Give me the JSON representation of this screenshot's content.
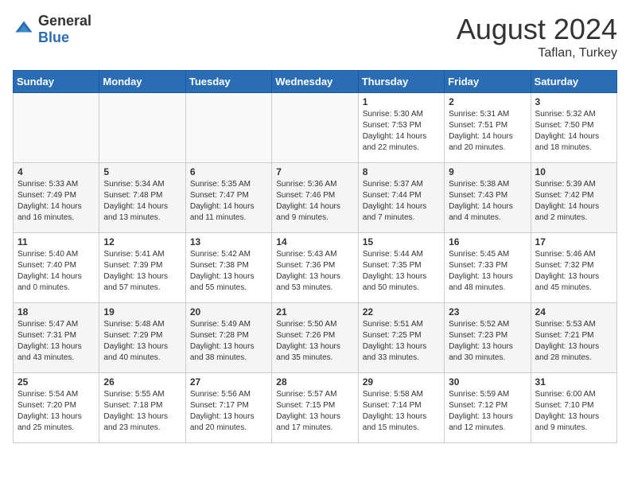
{
  "header": {
    "logo_general": "General",
    "logo_blue": "Blue",
    "month_year": "August 2024",
    "location": "Taflan, Turkey"
  },
  "days_of_week": [
    "Sunday",
    "Monday",
    "Tuesday",
    "Wednesday",
    "Thursday",
    "Friday",
    "Saturday"
  ],
  "weeks": [
    [
      {
        "day": "",
        "info": ""
      },
      {
        "day": "",
        "info": ""
      },
      {
        "day": "",
        "info": ""
      },
      {
        "day": "",
        "info": ""
      },
      {
        "day": "1",
        "info": "Sunrise: 5:30 AM\nSunset: 7:53 PM\nDaylight: 14 hours\nand 22 minutes."
      },
      {
        "day": "2",
        "info": "Sunrise: 5:31 AM\nSunset: 7:51 PM\nDaylight: 14 hours\nand 20 minutes."
      },
      {
        "day": "3",
        "info": "Sunrise: 5:32 AM\nSunset: 7:50 PM\nDaylight: 14 hours\nand 18 minutes."
      }
    ],
    [
      {
        "day": "4",
        "info": "Sunrise: 5:33 AM\nSunset: 7:49 PM\nDaylight: 14 hours\nand 16 minutes."
      },
      {
        "day": "5",
        "info": "Sunrise: 5:34 AM\nSunset: 7:48 PM\nDaylight: 14 hours\nand 13 minutes."
      },
      {
        "day": "6",
        "info": "Sunrise: 5:35 AM\nSunset: 7:47 PM\nDaylight: 14 hours\nand 11 minutes."
      },
      {
        "day": "7",
        "info": "Sunrise: 5:36 AM\nSunset: 7:46 PM\nDaylight: 14 hours\nand 9 minutes."
      },
      {
        "day": "8",
        "info": "Sunrise: 5:37 AM\nSunset: 7:44 PM\nDaylight: 14 hours\nand 7 minutes."
      },
      {
        "day": "9",
        "info": "Sunrise: 5:38 AM\nSunset: 7:43 PM\nDaylight: 14 hours\nand 4 minutes."
      },
      {
        "day": "10",
        "info": "Sunrise: 5:39 AM\nSunset: 7:42 PM\nDaylight: 14 hours\nand 2 minutes."
      }
    ],
    [
      {
        "day": "11",
        "info": "Sunrise: 5:40 AM\nSunset: 7:40 PM\nDaylight: 14 hours\nand 0 minutes."
      },
      {
        "day": "12",
        "info": "Sunrise: 5:41 AM\nSunset: 7:39 PM\nDaylight: 13 hours\nand 57 minutes."
      },
      {
        "day": "13",
        "info": "Sunrise: 5:42 AM\nSunset: 7:38 PM\nDaylight: 13 hours\nand 55 minutes."
      },
      {
        "day": "14",
        "info": "Sunrise: 5:43 AM\nSunset: 7:36 PM\nDaylight: 13 hours\nand 53 minutes."
      },
      {
        "day": "15",
        "info": "Sunrise: 5:44 AM\nSunset: 7:35 PM\nDaylight: 13 hours\nand 50 minutes."
      },
      {
        "day": "16",
        "info": "Sunrise: 5:45 AM\nSunset: 7:33 PM\nDaylight: 13 hours\nand 48 minutes."
      },
      {
        "day": "17",
        "info": "Sunrise: 5:46 AM\nSunset: 7:32 PM\nDaylight: 13 hours\nand 45 minutes."
      }
    ],
    [
      {
        "day": "18",
        "info": "Sunrise: 5:47 AM\nSunset: 7:31 PM\nDaylight: 13 hours\nand 43 minutes."
      },
      {
        "day": "19",
        "info": "Sunrise: 5:48 AM\nSunset: 7:29 PM\nDaylight: 13 hours\nand 40 minutes."
      },
      {
        "day": "20",
        "info": "Sunrise: 5:49 AM\nSunset: 7:28 PM\nDaylight: 13 hours\nand 38 minutes."
      },
      {
        "day": "21",
        "info": "Sunrise: 5:50 AM\nSunset: 7:26 PM\nDaylight: 13 hours\nand 35 minutes."
      },
      {
        "day": "22",
        "info": "Sunrise: 5:51 AM\nSunset: 7:25 PM\nDaylight: 13 hours\nand 33 minutes."
      },
      {
        "day": "23",
        "info": "Sunrise: 5:52 AM\nSunset: 7:23 PM\nDaylight: 13 hours\nand 30 minutes."
      },
      {
        "day": "24",
        "info": "Sunrise: 5:53 AM\nSunset: 7:21 PM\nDaylight: 13 hours\nand 28 minutes."
      }
    ],
    [
      {
        "day": "25",
        "info": "Sunrise: 5:54 AM\nSunset: 7:20 PM\nDaylight: 13 hours\nand 25 minutes."
      },
      {
        "day": "26",
        "info": "Sunrise: 5:55 AM\nSunset: 7:18 PM\nDaylight: 13 hours\nand 23 minutes."
      },
      {
        "day": "27",
        "info": "Sunrise: 5:56 AM\nSunset: 7:17 PM\nDaylight: 13 hours\nand 20 minutes."
      },
      {
        "day": "28",
        "info": "Sunrise: 5:57 AM\nSunset: 7:15 PM\nDaylight: 13 hours\nand 17 minutes."
      },
      {
        "day": "29",
        "info": "Sunrise: 5:58 AM\nSunset: 7:14 PM\nDaylight: 13 hours\nand 15 minutes."
      },
      {
        "day": "30",
        "info": "Sunrise: 5:59 AM\nSunset: 7:12 PM\nDaylight: 13 hours\nand 12 minutes."
      },
      {
        "day": "31",
        "info": "Sunrise: 6:00 AM\nSunset: 7:10 PM\nDaylight: 13 hours\nand 9 minutes."
      }
    ]
  ]
}
